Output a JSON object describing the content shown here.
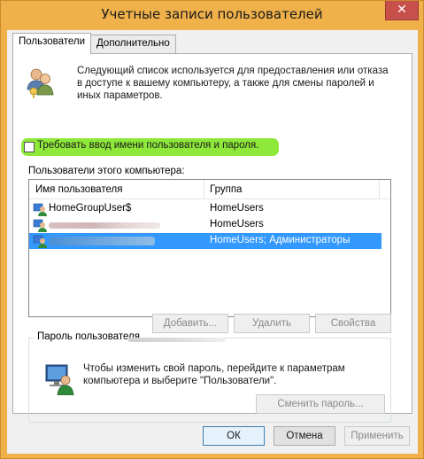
{
  "window": {
    "title": "Учетные записи пользователей",
    "close_glyph": "✕",
    "accent_color": "#f0b14b"
  },
  "tabs": [
    {
      "label": "Пользователи",
      "active": true
    },
    {
      "label": "Дополнительно",
      "active": false
    }
  ],
  "users_tab": {
    "icon": "users-icon",
    "info_text": "Следующий список используется для предоставления или отказа в доступе к вашему компьютеру, а также для смены паролей и иных параметров.",
    "require_checkbox": {
      "label": "Требовать ввод имени пользователя и пароля.",
      "checked": false
    },
    "list_caption": "Пользователи этого компьютера:",
    "columns": [
      "Имя пользователя",
      "Группа"
    ],
    "rows": [
      {
        "name": "HomeGroupUser$",
        "group": "HomeUsers",
        "icon": "user-icon",
        "selected": false
      },
      {
        "name": "",
        "group": "HomeUsers",
        "icon": "user-icon",
        "selected": false
      },
      {
        "name": "",
        "group": "HomeUsers; Администраторы",
        "icon": "user-icon",
        "selected": true
      }
    ],
    "buttons": {
      "add": "Добавить...",
      "remove": "Удалить",
      "properties": "Свойства"
    },
    "password_group": {
      "legend": "Пароль пользователя",
      "icon": "computer-user-icon",
      "text": "Чтобы изменить свой пароль, перейдите к параметрам компьютера и выберите \"Пользователи\".",
      "change_button": "Сменить пароль..."
    }
  },
  "footer": {
    "ok": "ОК",
    "cancel": "Отмена",
    "apply": "Применить"
  }
}
